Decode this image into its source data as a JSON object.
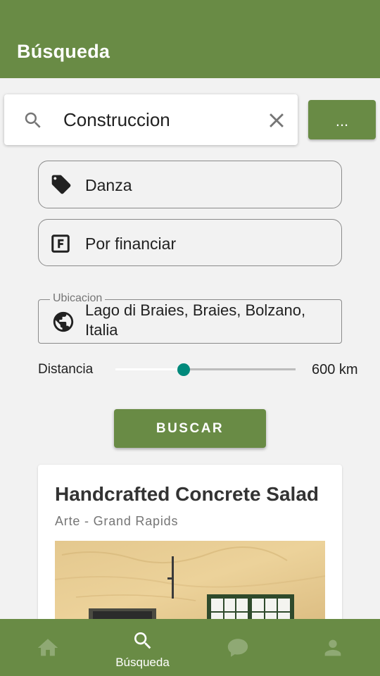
{
  "appbar": {
    "title": "Búsqueda"
  },
  "search": {
    "value": "Construccion",
    "icon": "search-icon"
  },
  "more_button": {
    "label": "..."
  },
  "category": {
    "label": "Danza",
    "icon": "tag-icon"
  },
  "financing": {
    "label": "Por financiar",
    "icon": "letter-f-box-icon"
  },
  "location": {
    "legend": "Ubicacion",
    "value": "Lago di Braies, Braies, Bolzano, Italia",
    "icon": "globe-icon"
  },
  "distance": {
    "label": "Distancia",
    "value": "600 km",
    "slider_fraction": 0.38
  },
  "search_button": {
    "label": "BUSCAR"
  },
  "result_card": {
    "title": "Handcrafted Concrete Salad",
    "subtitle": "Arte - Grand Rapids"
  },
  "bottom_nav": {
    "items": [
      {
        "icon": "home-icon",
        "label": ""
      },
      {
        "icon": "search-icon",
        "label": "Búsqueda",
        "active": true
      },
      {
        "icon": "chat-icon",
        "label": ""
      },
      {
        "icon": "person-icon",
        "label": ""
      }
    ]
  },
  "colors": {
    "primary": "#698b45",
    "accent": "#00897b",
    "background": "#f2f2f2",
    "inactive_icon": "#8fa974"
  }
}
